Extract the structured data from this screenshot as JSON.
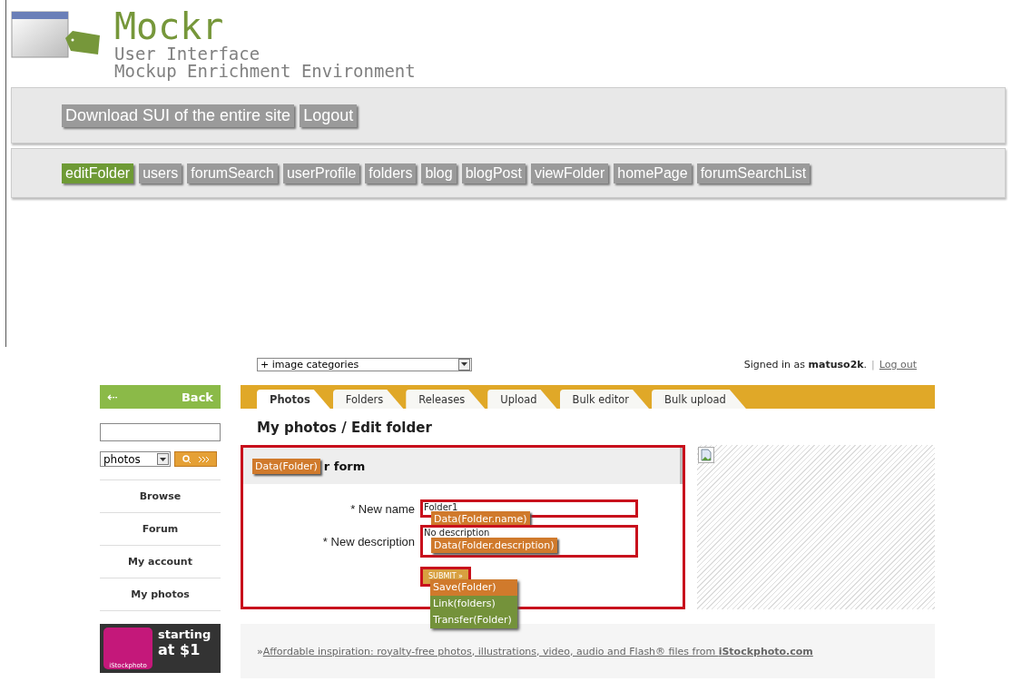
{
  "logo": {
    "title": "Mockr",
    "subtitle": [
      "User Interface",
      "Mockup Enrichment Environment"
    ]
  },
  "actions": [
    "Download SUI of the entire site",
    "Logout"
  ],
  "pages": [
    {
      "label": "editFolder",
      "selected": true
    },
    {
      "label": "users",
      "selected": false
    },
    {
      "label": "forumSearch",
      "selected": false
    },
    {
      "label": "userProfile",
      "selected": false
    },
    {
      "label": "folders",
      "selected": false
    },
    {
      "label": "blog",
      "selected": false
    },
    {
      "label": "blogPost",
      "selected": false
    },
    {
      "label": "viewFolder",
      "selected": false
    },
    {
      "label": "homePage",
      "selected": false
    },
    {
      "label": "forumSearchList",
      "selected": false
    }
  ],
  "site": {
    "category_select": "+ image categories",
    "signed_in": "Signed in as **matuso2k**.",
    "separator": "|",
    "log_out": "Log out",
    "sidebar": {
      "back": "Back",
      "back_arrow": "⇠",
      "scope_select": "photos",
      "nav": [
        "Browse",
        "Forum",
        "My account",
        "My photos"
      ],
      "ad": {
        "line_1": "starting",
        "line_2": "at $1",
        "brand": "iStockphoto"
      }
    },
    "tabs": [
      {
        "label": "Photos",
        "selected": true
      },
      {
        "label": "Folders",
        "selected": false
      },
      {
        "label": "Releases",
        "selected": false
      },
      {
        "label": "Upload",
        "selected": false
      },
      {
        "label": "Bulk editor",
        "selected": false
      },
      {
        "label": "Bulk upload",
        "selected": false
      }
    ],
    "heading": "My photos / Edit folder",
    "form": {
      "title": "r form",
      "annotation": "Data(Folder)",
      "fields": [
        {
          "kind": "input",
          "label": "* New name",
          "value": "Folder1",
          "annotation": "Data(Folder.name)"
        },
        {
          "kind": "textarea",
          "label": "* New description",
          "value": "No description",
          "annotation": "Data(Folder.description)"
        }
      ],
      "submit": "SUBMIT  »",
      "submit_annotations": [
        {
          "label": "Save(Folder)",
          "color": "#d07a2c"
        },
        {
          "label": "Link(folders)",
          "color": "#74923a"
        },
        {
          "label": "Transfer(Folder)",
          "color": "#74923a"
        }
      ]
    },
    "footer": {
      "prefix": "»",
      "link": "Affordable inspiration: royalty-free photos, illustrations, video, audio and Flash® files from **iStockphoto.com**"
    }
  }
}
